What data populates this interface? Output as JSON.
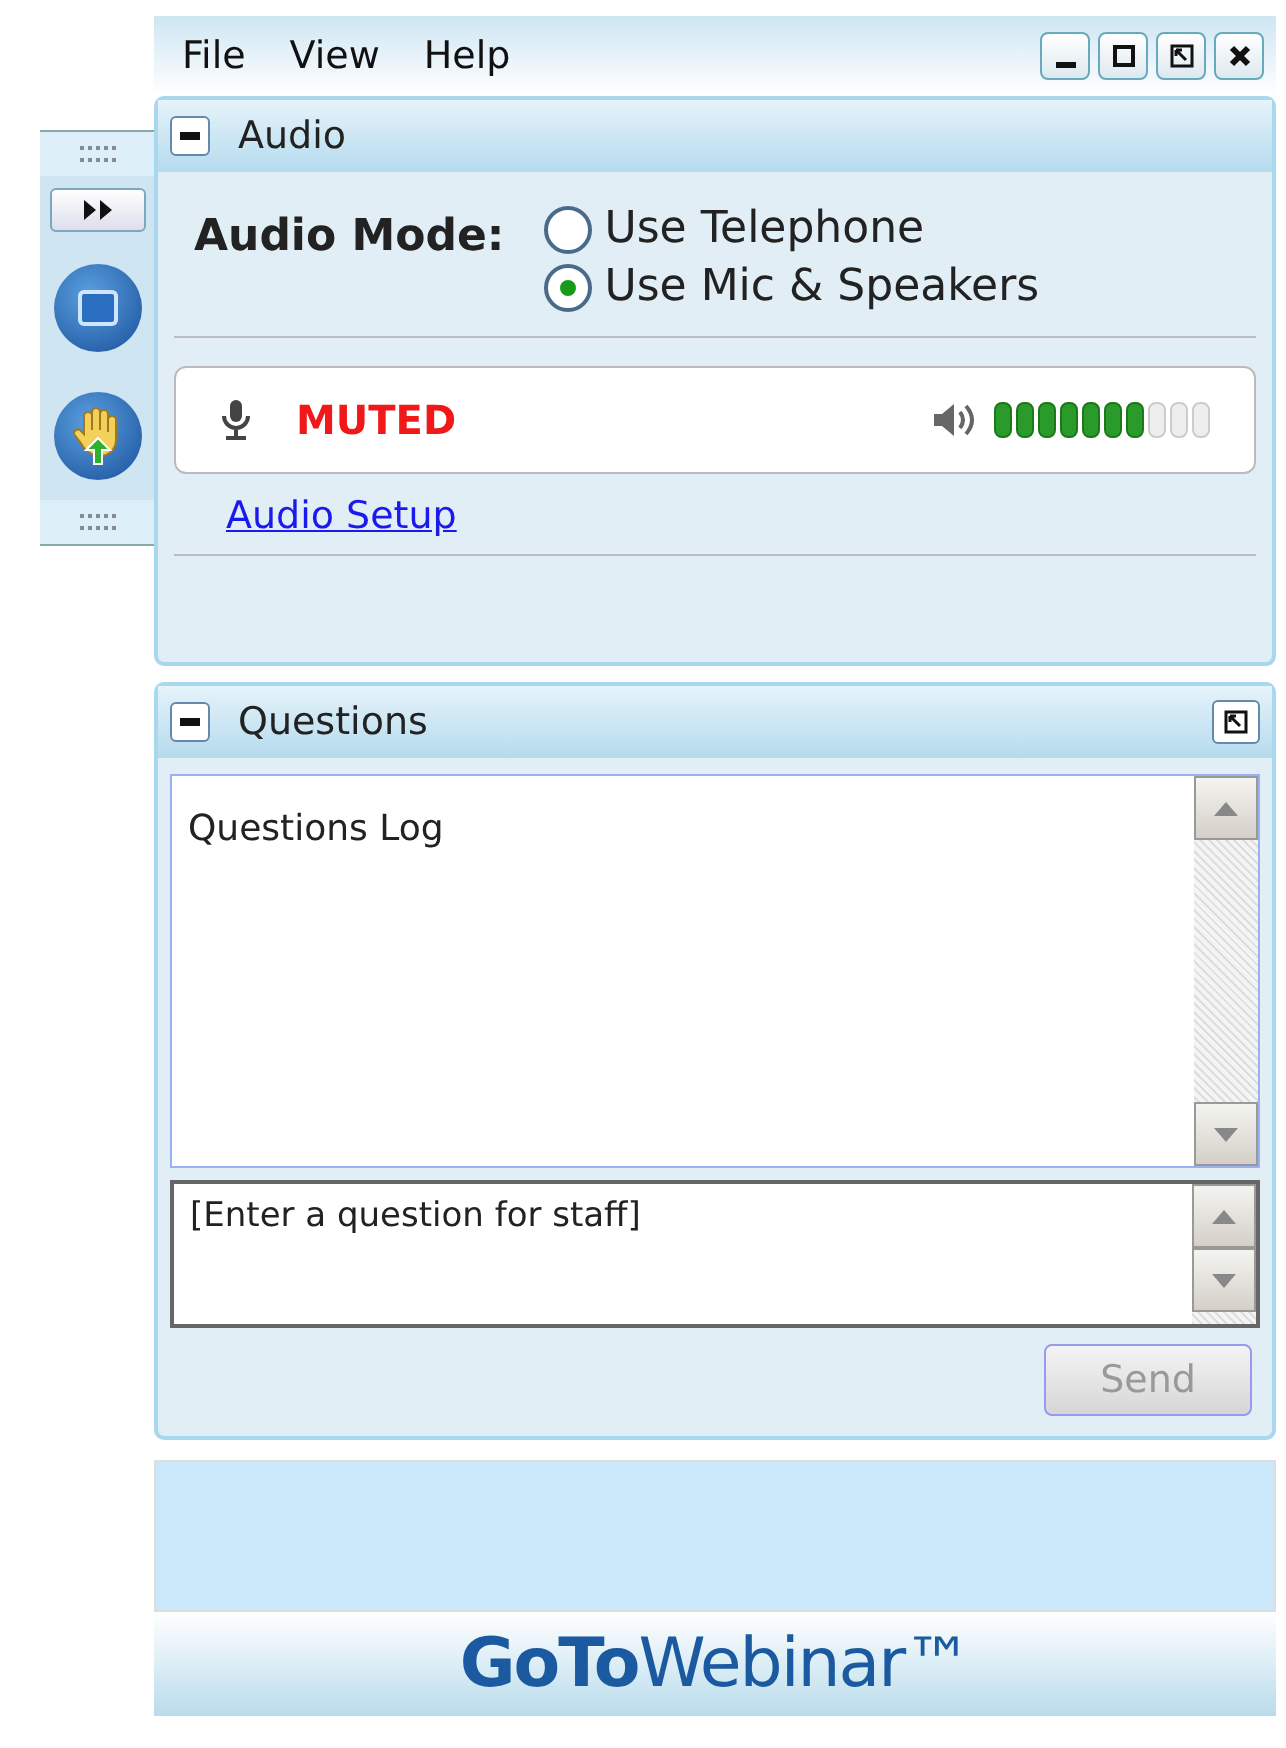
{
  "menu": [
    "File",
    "View",
    "Help"
  ],
  "window_buttons": [
    {
      "kind": "minimize"
    },
    {
      "kind": "maximize"
    },
    {
      "kind": "restore"
    },
    {
      "kind": "close"
    }
  ],
  "toolbar": [
    {
      "kind": "expand"
    },
    {
      "kind": "screen"
    },
    {
      "kind": "hand"
    }
  ],
  "audio": {
    "title": "Audio",
    "mode_label": "Audio Mode:",
    "options": [
      {
        "label": "Use Telephone",
        "selected": false
      },
      {
        "label": "Use Mic & Speakers",
        "selected": true
      }
    ],
    "mic_status": "MUTED",
    "volume": {
      "level": 0.7
    },
    "setup_link": "Audio Setup"
  },
  "questions": {
    "title": "Questions",
    "log": "Questions Log",
    "placeholder": "[Enter a question for staff]",
    "send": {
      "label": "Send",
      "disabled": true
    }
  },
  "logo": "**GoTo**Webinar™"
}
